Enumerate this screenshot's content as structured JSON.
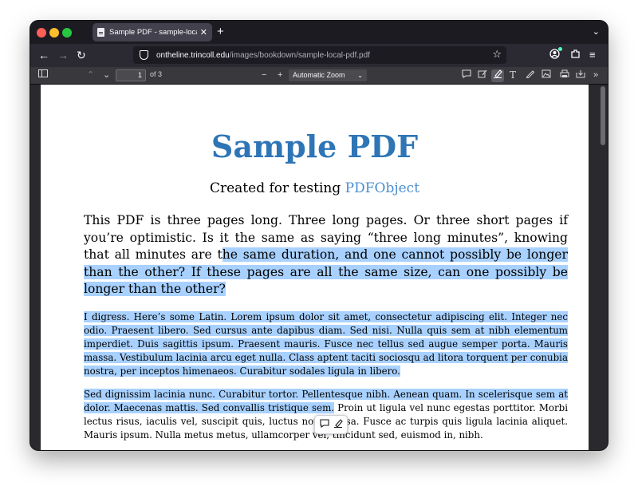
{
  "browser": {
    "tab": {
      "title": "Sample PDF - sample-local-pdf",
      "close_glyph": "✕"
    },
    "new_tab_glyph": "+",
    "tabs_menu_glyph": "⌄",
    "url": {
      "host": "ontheline.trincoll.edu",
      "path": "/images/bookdown/sample-local-pdf.pdf"
    },
    "nav_icons": [
      "back-icon",
      "forward-icon",
      "reload-icon",
      "shield-icon",
      "bookmark-star-icon",
      "account-icon",
      "extensions-icon",
      "menu-icon"
    ]
  },
  "pdf_toolbar": {
    "page_number": "1",
    "page_count_label": "of 3",
    "zoom_label": "Automatic Zoom",
    "icons": [
      "sidebar-toggle-icon",
      "previous-page-icon",
      "next-page-icon",
      "zoom-out-icon",
      "zoom-in-icon",
      "comment-icon",
      "signature-icon",
      "highlight-icon",
      "text-icon",
      "draw-icon",
      "image-icon",
      "print-icon",
      "save-icon",
      "tools-icon"
    ]
  },
  "document": {
    "title": "Sample PDF",
    "subtitle_prefix": "Created for testing ",
    "subtitle_link": "PDFObject",
    "para1_plain": "This PDF is three pages long. Three long pages. Or three short pages if you’re optimistic. Is it the same as saying “three long minutes”, knowing that all minutes are t",
    "para1_highlight": "he same duration, and one cannot possibly be longer than the other? If these pages are all the same size, can one possibly be longer than the other?",
    "para2_highlight": "I digress. Here’s some Latin. Lorem ipsum dolor sit amet, consectetur adipiscing elit. Integer nec odio. Praesent libero. Sed cursus ante dapibus diam. Sed nisi. Nulla quis sem at nibh elementum imperdiet. Duis sagittis ipsum. Praesent mauris. Fusce nec tellus sed augue semper porta. Mauris massa. Vestibulum lacinia arcu eget nulla. Class aptent taciti sociosqu ad litora torquent per conubia nostra, per inceptos himenaeos. Curabitur sodales ligula in libero.",
    "para3_highlight": "Sed dignissim lacinia nunc. Curabitur tortor. Pellentesque nibh. Aenean quam. In scelerisque sem at dolor. Maecenas mattis. Sed convallis tristique sem.",
    "para3_plain": " Proin ut ligula vel nunc egestas porttitor. Morbi lectus risus, iaculis vel, suscipit quis, luctus non, massa. Fusce ac turpis quis ligula lacinia aliquet. Mauris ipsum. Nulla metus metus, ullamcorper vel, tincidunt sed, euismod in, nibh."
  },
  "selection_popup": {
    "icons": [
      "add-comment-icon",
      "highlight-pen-icon"
    ]
  },
  "colors": {
    "title_blue": "#2e75b6",
    "link_blue": "#4a8ed0",
    "selection": "#a8d1ff"
  }
}
